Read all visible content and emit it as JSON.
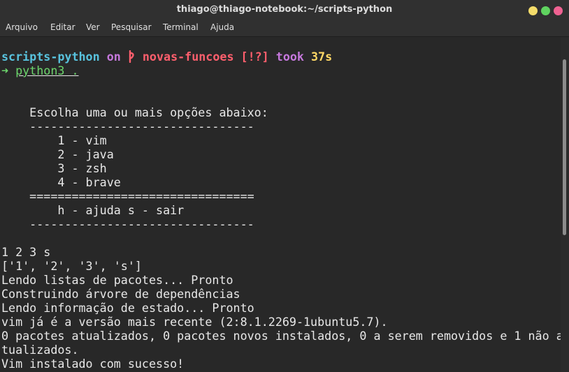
{
  "window": {
    "title": "thiago@thiago-notebook:~/scripts-python"
  },
  "menu": [
    "Arquivo",
    "Editar",
    "Ver",
    "Pesquisar",
    "Terminal",
    "Ajuda"
  ],
  "prompt": {
    "dir": "scripts-python",
    "on": "on",
    "branch_icon": "",
    "branch": "novas-funcoes",
    "status": "[!?]",
    "took": "took",
    "duration": "37s",
    "arrow": "➜",
    "command": "python3 ."
  },
  "menu_lines": {
    "title": "    Escolha uma ou mais opções abaixo:",
    "rule1": "    --------------------------------",
    "opt1": "        1 - vim",
    "opt2": "        2 - java",
    "opt3": "        3 - zsh",
    "opt4": "        4 - brave",
    "rule2": "    ================================",
    "help": "        h - ajuda s - sair",
    "rule3": "    --------------------------------"
  },
  "output": [
    "1 2 3 s",
    "['1', '2', '3', 's']",
    "Lendo listas de pacotes... Pronto",
    "Construindo árvore de dependências",
    "Lendo informação de estado... Pronto",
    "vim já é a versão mais recente (2:8.1.2269-1ubuntu5.7).",
    "0 pacotes atualizados, 0 pacotes novos instalados, 0 a serem removidos e 1 não a",
    "tualizados.",
    "Vim instalado com sucesso!"
  ],
  "colors": {
    "dir": "#58c2dd",
    "keyword": "#c678dd",
    "branch": "#ff5f6d",
    "duration": "#ffd866",
    "prompt_arrow": "#6cd66c"
  },
  "icons": {
    "branch": "git-branch-icon",
    "minimize": "minimize-icon",
    "maximize": "maximize-icon",
    "close": "close-icon"
  }
}
